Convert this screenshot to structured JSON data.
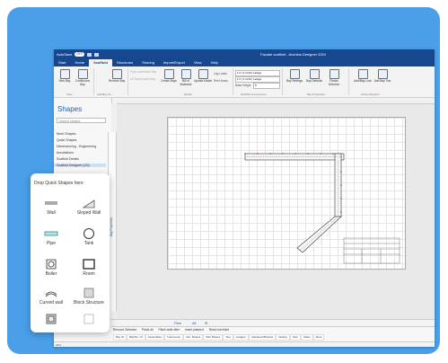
{
  "titlebar": {
    "autosave_label": "AutoSave",
    "autosave_state": "OFF",
    "title": "Facade scaffold - Avontus Designer 2024"
  },
  "menu": {
    "tabs": [
      "Start",
      "Home",
      "Scaffold",
      "Structures",
      "Shoring",
      "Import/Export",
      "View",
      "Help"
    ],
    "active_index": 2
  },
  "ribbon": {
    "view_group": {
      "new_bay": "New Bay",
      "continuous_bay": "Continuous Bay",
      "label": "View"
    },
    "add_bay_group": {
      "label": "Add Bay To...",
      "remove_bay": "Remove Bay"
    },
    "modify_group": {
      "label": "Modify",
      "small1": "Pipe connection Bay",
      "small2": "Ab Board scale Bay",
      "create_bays": "Create Bays",
      "bill_of_materials": "Bill of Materials",
      "update_model": "Update Model",
      "leg_loads": "Leg Loads",
      "reef_areas": "Reef Areas"
    },
    "scaffold_components": {
      "sel1": "1 ft | 3 in/10 | Ledger",
      "sel2": "1 ft | 3 in/10 | Ledger",
      "base_height_label": "Base Height",
      "base_height_value": "0",
      "label": "Scaffold Components"
    },
    "bay_tools": {
      "label": "Bay Properties",
      "item1": "Bay Settings",
      "item2": "Bay Defaults",
      "item3": "Planks Direction"
    },
    "lock": {
      "label": "Actions/System",
      "item1": "Add/Bay Lock",
      "item2": "Add Bay Tow"
    }
  },
  "shapes_panel": {
    "title": "Shapes",
    "search_placeholder": "Search shapes",
    "items": [
      "More Shapes",
      "Quick Shapes",
      "Dimensioning - Engineering",
      "Annotations",
      "Scaffold Details",
      "Scaffold Designer (US)"
    ],
    "selected_index": 5
  },
  "quick_shapes": {
    "header": "Drop Quick Shapes here",
    "items": [
      "Wall",
      "Sloped Wall",
      "Pipe",
      "Tank",
      "Boiler",
      "Room",
      "Curved wall",
      "Block Structure",
      "",
      ""
    ]
  },
  "canvas": {
    "side_tab": "Bay Properties"
  },
  "page_tabs": {
    "page1": "Plan",
    "all": "All"
  },
  "bottom_panel": {
    "toolbar": [
      "Remove Selected",
      "Plank all",
      "Plank wide after",
      "Insert planked",
      "Read overrides"
    ],
    "columns": [
      "Bay ID",
      "Bay/No. Of",
      "Assemblies",
      "Transverse",
      "Vert. Braces",
      "Mtm Braces",
      "Ties",
      "Ledgers",
      "Cantilever/Bracket",
      "Netting",
      "Stop",
      "Stairs",
      "More"
    ]
  },
  "status": {
    "text": "93%"
  },
  "colors": {
    "brand": "#17478f",
    "background_panel": "#4a9fe8",
    "accent": "#1f5fae"
  }
}
